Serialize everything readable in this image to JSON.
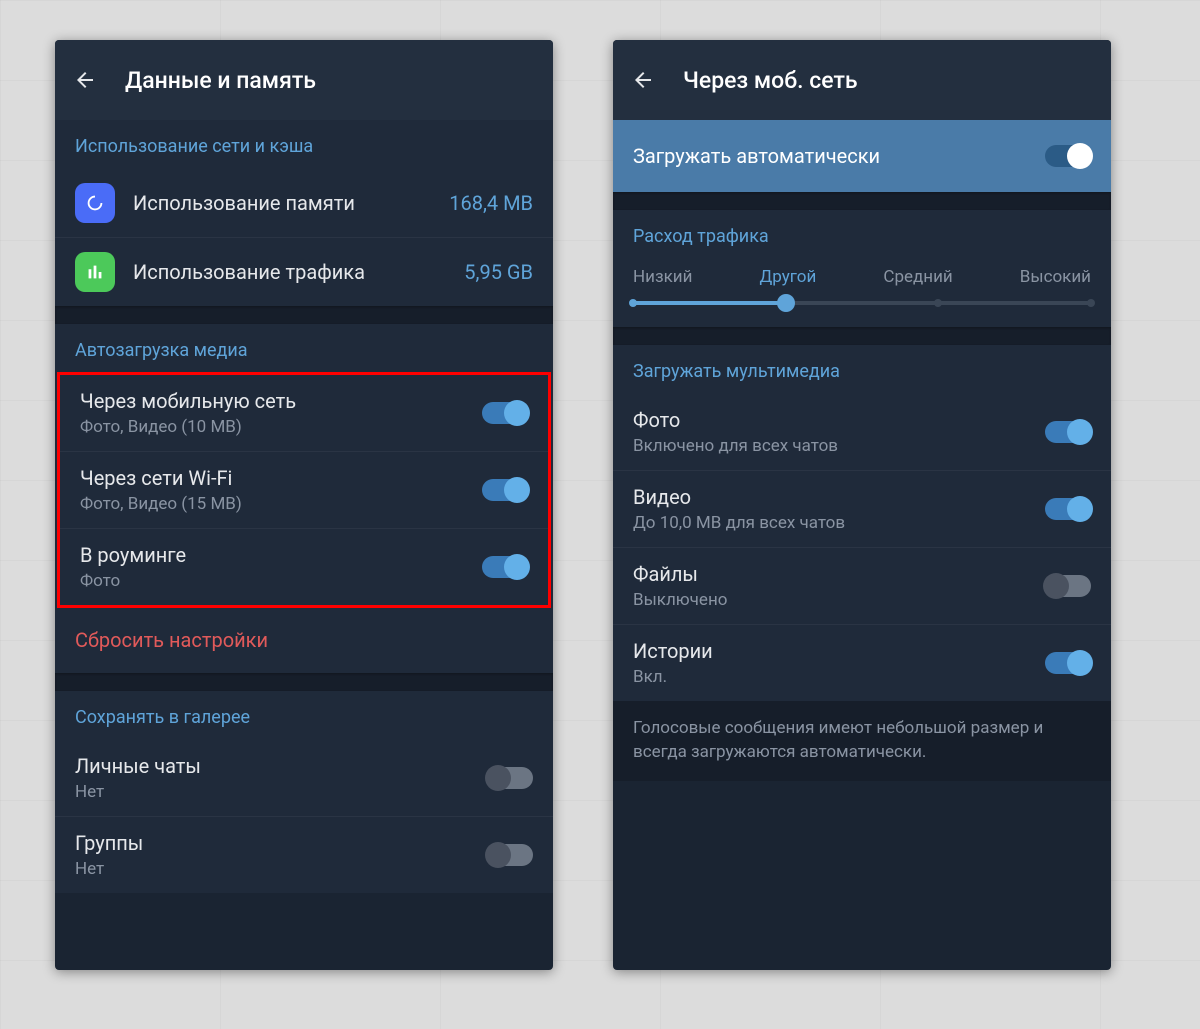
{
  "screen1": {
    "title": "Данные и память",
    "usage": {
      "header": "Использование сети и кэша",
      "storage": {
        "label": "Использование памяти",
        "value": "168,4 MB"
      },
      "data": {
        "label": "Использование трафика",
        "value": "5,95 GB"
      }
    },
    "autodownload": {
      "header": "Автозагрузка медиа",
      "mobile": {
        "label": "Через мобильную сеть",
        "sub": "Фото, Видео (10 MB)"
      },
      "wifi": {
        "label": "Через сети Wi-Fi",
        "sub": "Фото, Видео (15 MB)"
      },
      "roaming": {
        "label": "В роуминге",
        "sub": "Фото"
      },
      "reset": "Сбросить настройки"
    },
    "gallery": {
      "header": "Сохранять в галерее",
      "private": {
        "label": "Личные чаты",
        "sub": "Нет"
      },
      "groups": {
        "label": "Группы",
        "sub": "Нет"
      }
    }
  },
  "screen2": {
    "title": "Через моб. сеть",
    "master": "Загружать автоматически",
    "traffic": {
      "header": "Расход трафика",
      "labels": [
        "Низкий",
        "Другой",
        "Средний",
        "Высокий"
      ],
      "active_index": 1
    },
    "media": {
      "header": "Загружать мультимедиа",
      "photo": {
        "label": "Фото",
        "sub": "Включено для всех чатов",
        "on": true
      },
      "video": {
        "label": "Видео",
        "sub": "До 10,0 MB для всех чатов",
        "on": true
      },
      "files": {
        "label": "Файлы",
        "sub": "Выключено",
        "on": false
      },
      "stories": {
        "label": "Истории",
        "sub": "Вкл.",
        "on": true
      }
    },
    "note": "Голосовые сообщения имеют небольшой размер и всегда загружаются автоматически."
  }
}
